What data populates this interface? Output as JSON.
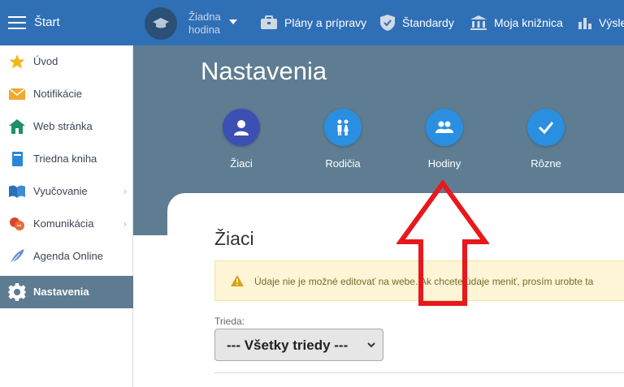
{
  "topbar": {
    "start_label": "Štart",
    "hour_selector": "Žiadna hodina",
    "hour_line1": "Žiadna",
    "hour_line2": "hodina",
    "nav": [
      {
        "label": "Plány a prípravy",
        "icon": "briefcase-icon"
      },
      {
        "label": "Štandardy",
        "icon": "shield-check-icon"
      },
      {
        "label": "Moja knižnica",
        "icon": "library-icon"
      },
      {
        "label": "Výsle",
        "icon": "bar-chart-icon"
      }
    ]
  },
  "sidebar": {
    "items": [
      {
        "label": "Úvod",
        "icon": "star-icon"
      },
      {
        "label": "Notifikácie",
        "icon": "envelope-icon"
      },
      {
        "label": "Web stránka",
        "icon": "home-icon"
      },
      {
        "label": "Triedna kniha",
        "icon": "book-icon"
      },
      {
        "label": "Vyučovanie",
        "icon": "open-book-icon",
        "chevron": "›"
      },
      {
        "label": "Komunikácia",
        "icon": "chat-icon",
        "chevron": "›"
      },
      {
        "label": "Agenda Online",
        "icon": "feather-icon"
      },
      {
        "label": "Nastavenia",
        "icon": "gear-icon",
        "active": true
      }
    ]
  },
  "main": {
    "title": "Nastavenia",
    "tiles": [
      {
        "label": "Žiaci",
        "icon": "student-icon",
        "color": "#3d4fb3"
      },
      {
        "label": "Rodičia",
        "icon": "parents-icon",
        "color": "#2a8fe0"
      },
      {
        "label": "Hodiny",
        "icon": "group-icon",
        "color": "#2a8fe0"
      },
      {
        "label": "Rôzne",
        "icon": "check-icon",
        "color": "#2a8fe0"
      }
    ]
  },
  "card": {
    "title": "Žiaci",
    "alert_text": "Údaje nie je možné editovať na webe. Ak chcete údaje meniť, prosím urobte ta",
    "class_label": "Trieda:",
    "class_select_value": "--- Všetky triedy ---"
  },
  "colors": {
    "topbar": "#2f6fb6",
    "header_bg": "#5e7d92",
    "annotation_arrow": "#e8181d"
  }
}
